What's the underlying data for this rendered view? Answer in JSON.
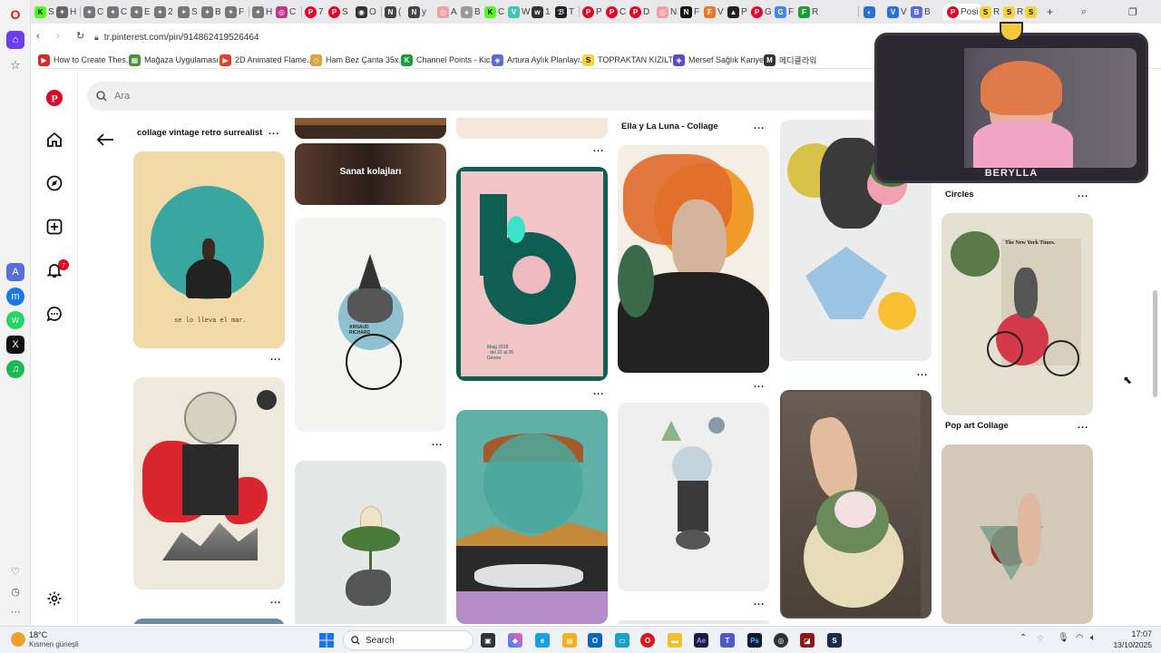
{
  "browser": {
    "url": "tr.pinterest.com/pin/914862419526464",
    "tabs": [
      "S",
      "H",
      "C",
      "C",
      "E",
      "2",
      "S",
      "B",
      "F",
      "H",
      "C",
      "7",
      "S",
      "O",
      "(",
      "y",
      "A",
      "B",
      "C",
      "W",
      "1",
      "T",
      "P",
      "C",
      "D",
      "N",
      "F",
      "V",
      "P",
      "G",
      "F",
      "R",
      "V",
      "B",
      "Posi",
      "R",
      "R"
    ],
    "bookmarks": [
      {
        "label": "How to Create Thes...",
        "color": "#d62b2b"
      },
      {
        "label": "Mağaza Uygulaması...",
        "color": "#4a8f3c"
      },
      {
        "label": "2D Animated Flame...",
        "color": "#e0422f"
      },
      {
        "label": "Ham Bez Çanta 35x...",
        "color": "#d9a441"
      },
      {
        "label": "Channel Points - Kic...",
        "color": "#1e9c3a"
      },
      {
        "label": "Artura Aylık Planlayı...",
        "color": "#5b6bd8"
      },
      {
        "label": "TOPRAKTAN KIZILT...",
        "color": "#f1d43a"
      },
      {
        "label": "Mersef Sağlık Kariye...",
        "color": "#5a4cc4"
      },
      {
        "label": "메디클라워",
        "color": "#333333"
      }
    ]
  },
  "pinterest": {
    "search_placeholder": "Ara",
    "notification_count": "7",
    "more_label": "...",
    "titles": {
      "col1_top": "collage vintage retro surrealist",
      "col2_card": "Sanat kolajları",
      "col4_top": "Ella y La Luna - Collage",
      "col6_top": "Circles",
      "col6_mid": "Pop art Collage"
    },
    "poster_text": {
      "sea": "se lo lleva el mar.",
      "unicycle": "ARNAUD\nRICHARD",
      "flower_poster": "Maig 2018\n· del 22 al 26\nGirona",
      "newspaper": "The New York Times."
    }
  },
  "stream_overlay": {
    "name": "BERYLLA"
  },
  "taskbar": {
    "weather_temp": "18°C",
    "weather_desc": "Kısmen güneşli",
    "search_label": "Search",
    "time": "17:07",
    "date": "13/10/2025"
  }
}
